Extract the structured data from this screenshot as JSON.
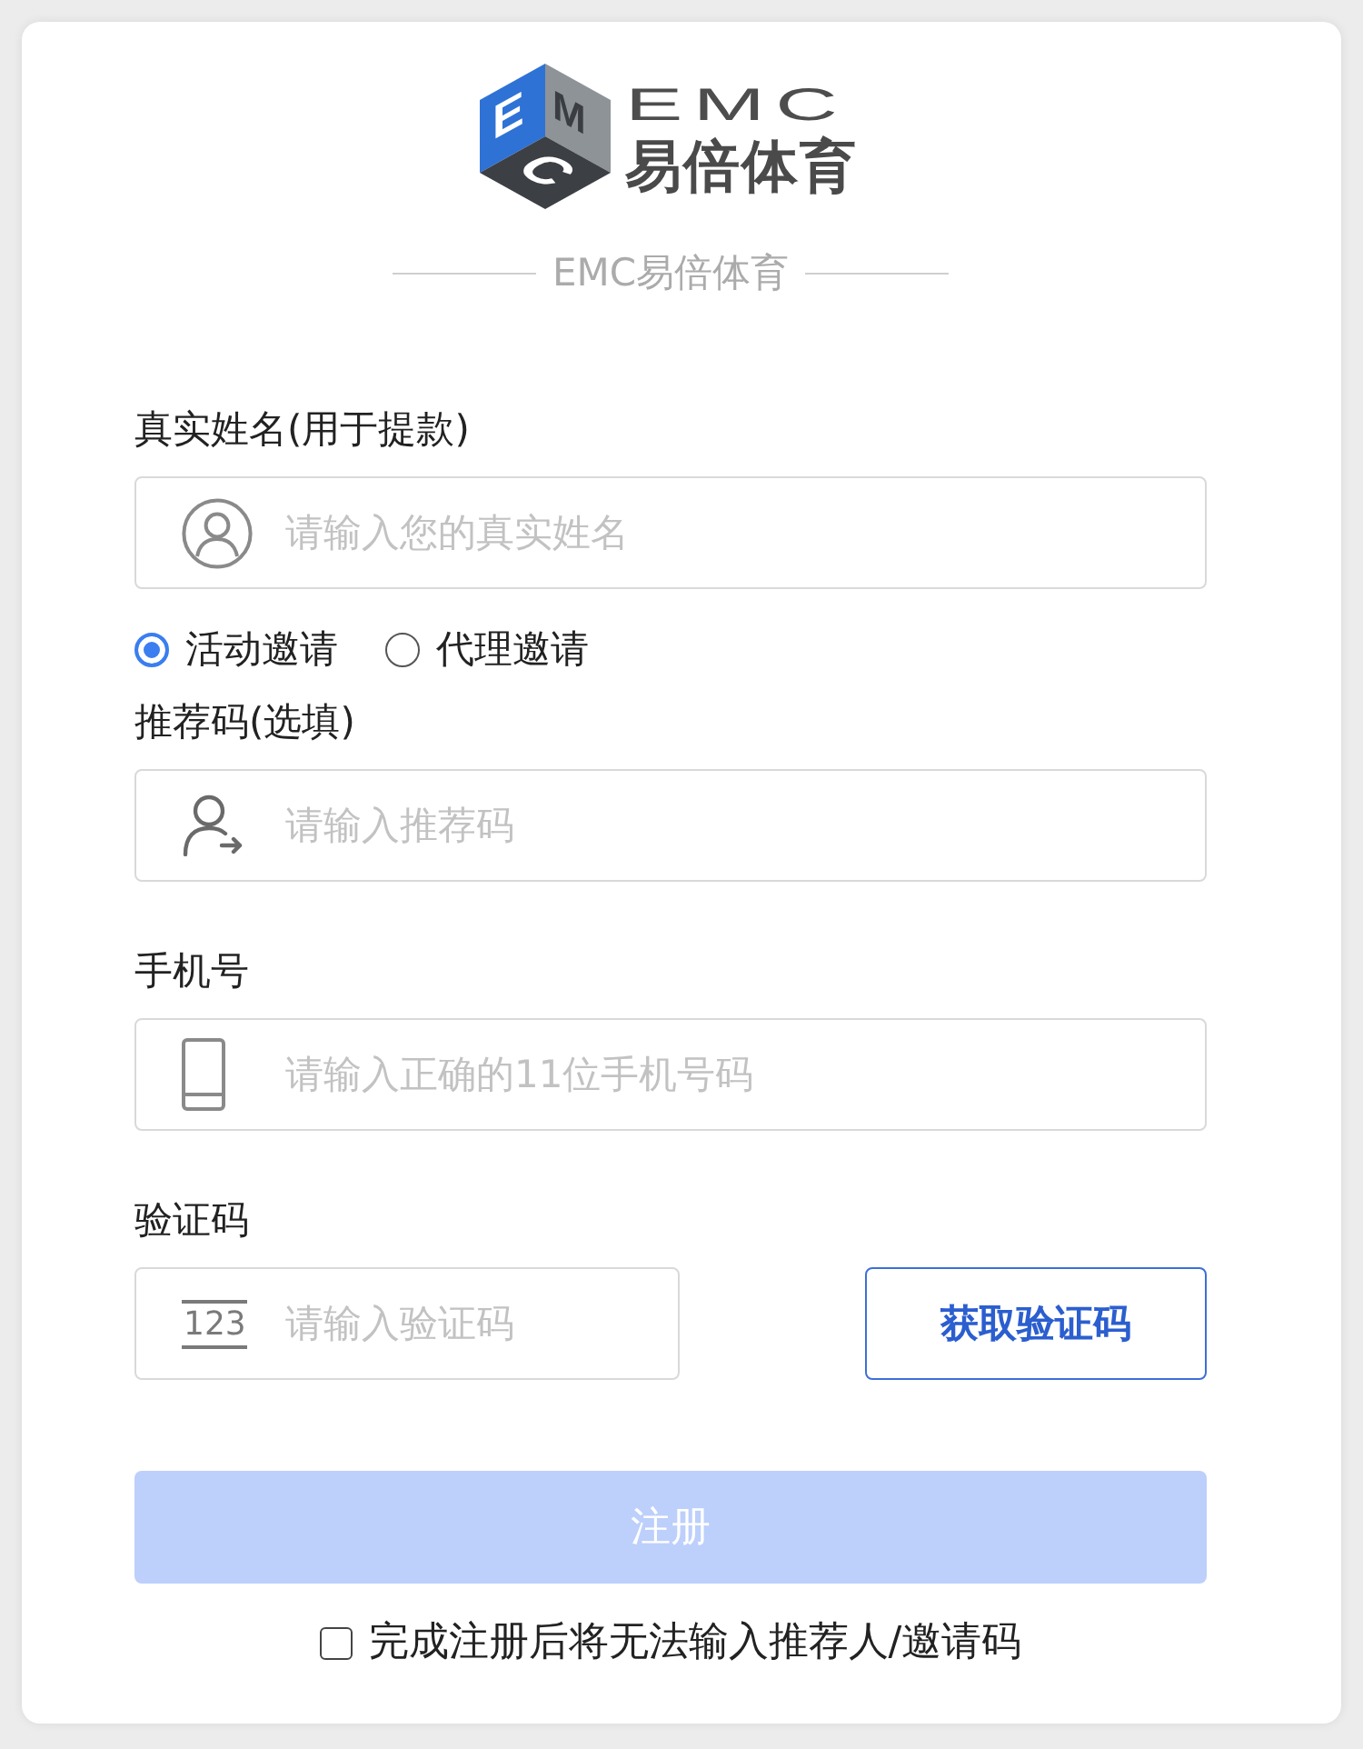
{
  "logo": {
    "cube_letters": [
      "E",
      "M",
      "C"
    ],
    "wordmark": "EMC",
    "name": "易倍体育"
  },
  "caption": "EMC易倍体育",
  "name_field": {
    "kind": "name",
    "label": "真实姓名(用于提款)",
    "placeholder": "请输入您的真实姓名"
  },
  "invite_type": [
    {
      "label": "活动邀请",
      "selected": true
    },
    {
      "label": "代理邀请",
      "selected": false
    }
  ],
  "fields": [
    {
      "kind": "referral",
      "label": "推荐码(选填)",
      "placeholder": "请输入推荐码"
    },
    {
      "kind": "phone",
      "label": "手机号",
      "placeholder": "请输入正确的11位手机号码"
    },
    {
      "kind": "code",
      "label": "验证码",
      "placeholder": "请输入验证码",
      "icon_text": "123",
      "button": "获取验证码"
    }
  ],
  "register_button": {
    "label": "注册",
    "disabled": true
  },
  "agreement": {
    "label": "完成注册后将无法输入推荐人/邀请码",
    "checked": false
  }
}
